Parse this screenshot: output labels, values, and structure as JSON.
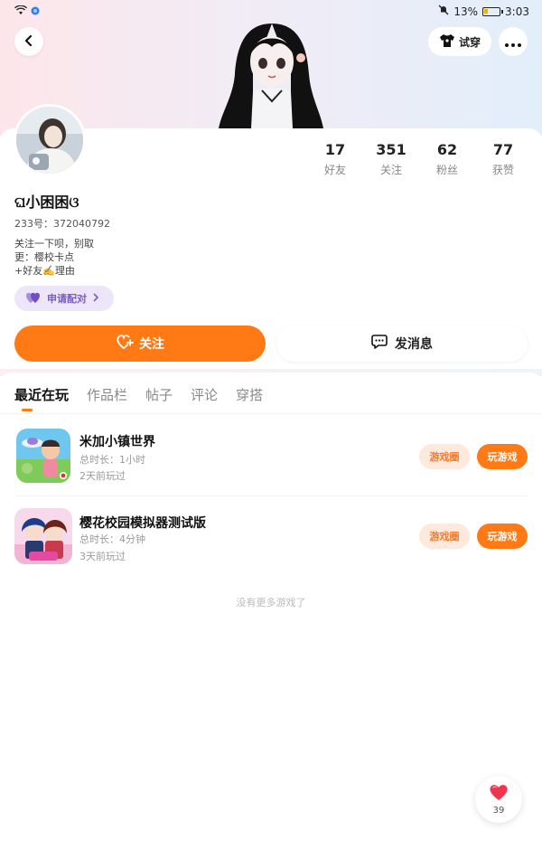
{
  "status_bar": {
    "battery_percent": "13%",
    "time": "3:03"
  },
  "header": {
    "tryon_label": "试穿"
  },
  "profile": {
    "stats": [
      {
        "value": "17",
        "label": "好友"
      },
      {
        "value": "351",
        "label": "关注"
      },
      {
        "value": "62",
        "label": "粉丝"
      },
      {
        "value": "77",
        "label": "获赞"
      }
    ],
    "username": "ଘ小困困ଓ",
    "uid": "233号：372040792",
    "bio": [
      "关注一下呗，别取",
      "更：樱校卡点",
      "+好友✍️理由"
    ],
    "pair_label": "申请配对",
    "follow_label": "关注",
    "message_label": "发消息"
  },
  "tabs": [
    {
      "label": "最近在玩",
      "active": true
    },
    {
      "label": "作品栏",
      "active": false
    },
    {
      "label": "帖子",
      "active": false
    },
    {
      "label": "评论",
      "active": false
    },
    {
      "label": "穿搭",
      "active": false
    }
  ],
  "games": [
    {
      "title": "米加小镇世界",
      "duration": "总时长：1小时",
      "last_played": "2天前玩过",
      "circle_label": "游戏圈",
      "play_label": "玩游戏"
    },
    {
      "title": "樱花校园模拟器测试版",
      "duration": "总时长：4分钟",
      "last_played": "3天前玩过",
      "circle_label": "游戏圈",
      "play_label": "玩游戏"
    }
  ],
  "no_more_text": "没有更多游戏了",
  "like_count": "39",
  "colors": {
    "accent": "#ff7a15",
    "pair": "#7b5cc7"
  }
}
